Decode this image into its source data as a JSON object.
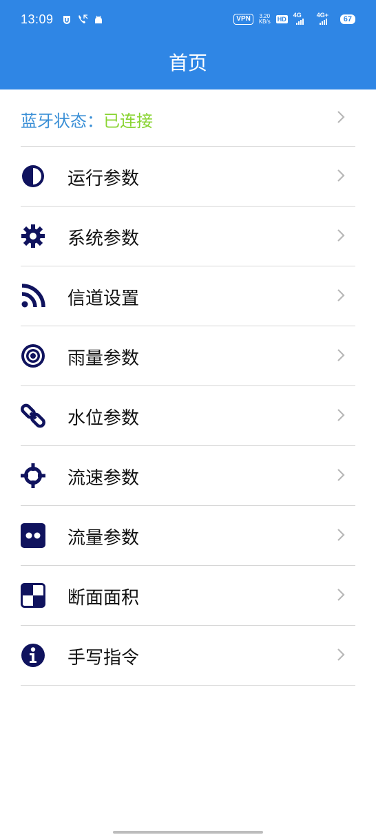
{
  "status_bar": {
    "time": "13:09",
    "vpn": "VPN",
    "speed_value": "3.20",
    "speed_unit": "KB/s",
    "hd": "HD",
    "sim1": "4G",
    "sim2": "4G+",
    "battery": "67"
  },
  "header": {
    "title": "首页"
  },
  "bluetooth": {
    "label": "蓝牙状态：",
    "value": "已连接"
  },
  "menu": [
    {
      "label": "运行参数",
      "icon": "half-circle-icon"
    },
    {
      "label": "系统参数",
      "icon": "gear-icon"
    },
    {
      "label": "信道设置",
      "icon": "rss-icon"
    },
    {
      "label": "雨量参数",
      "icon": "target-icon"
    },
    {
      "label": "水位参数",
      "icon": "chain-link-icon"
    },
    {
      "label": "流速参数",
      "icon": "crosshair-icon"
    },
    {
      "label": "流量参数",
      "icon": "two-dots-icon"
    },
    {
      "label": "断面面积",
      "icon": "checker-square-icon"
    },
    {
      "label": "手写指令",
      "icon": "info-icon"
    }
  ],
  "colors": {
    "app_bar": "#2f86e5",
    "bluetooth_label": "#3a8fd6",
    "bluetooth_connected": "#8ad433",
    "icon": "#10135e",
    "divider": "#d6d6d6",
    "chevron": "#b8b8b8"
  }
}
